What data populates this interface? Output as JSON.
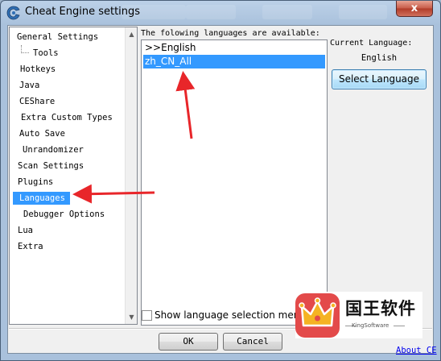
{
  "window": {
    "title": "Cheat Engine settings",
    "close_label": "x"
  },
  "sidebar": {
    "items": [
      {
        "label": "General Settings",
        "selected": false
      },
      {
        "label": "Tools",
        "selected": false
      },
      {
        "label": "Hotkeys",
        "selected": false
      },
      {
        "label": "Java",
        "selected": false
      },
      {
        "label": "CEShare",
        "selected": false
      },
      {
        "label": "Extra Custom Types",
        "selected": false
      },
      {
        "label": "Auto Save",
        "selected": false
      },
      {
        "label": "Unrandomizer",
        "selected": false
      },
      {
        "label": "Scan Settings",
        "selected": false
      },
      {
        "label": "Plugins",
        "selected": false
      },
      {
        "label": "Languages",
        "selected": true
      },
      {
        "label": "Debugger Options",
        "selected": false
      },
      {
        "label": "Lua",
        "selected": false
      },
      {
        "label": "Extra",
        "selected": false
      }
    ]
  },
  "languages": {
    "header": "The folowing languages are available:",
    "items": [
      {
        "label": ">>English",
        "selected": false
      },
      {
        "label": "zh_CN_All",
        "selected": true
      }
    ],
    "current_label": "Current Language:",
    "current_value": "English",
    "select_button": "Select Language",
    "show_checkbox_label": "Show language selection menu",
    "show_checked": false
  },
  "footer": {
    "ok": "OK",
    "cancel": "Cancel",
    "about": "About CE"
  },
  "watermark": {
    "title": "国王软件",
    "subtitle": "KingSoftware"
  },
  "colors": {
    "selection": "#3399ff",
    "annotation_arrow": "#e8262a",
    "title_bar": "#bcd1e8",
    "watermark_badge": "#e34a4a",
    "crown": "#f5b323"
  },
  "icons": {
    "app": "cheat-engine-icon",
    "close": "close-icon",
    "scroll_up": "scroll-up-arrow-icon",
    "scroll_down": "scroll-down-arrow-icon"
  }
}
